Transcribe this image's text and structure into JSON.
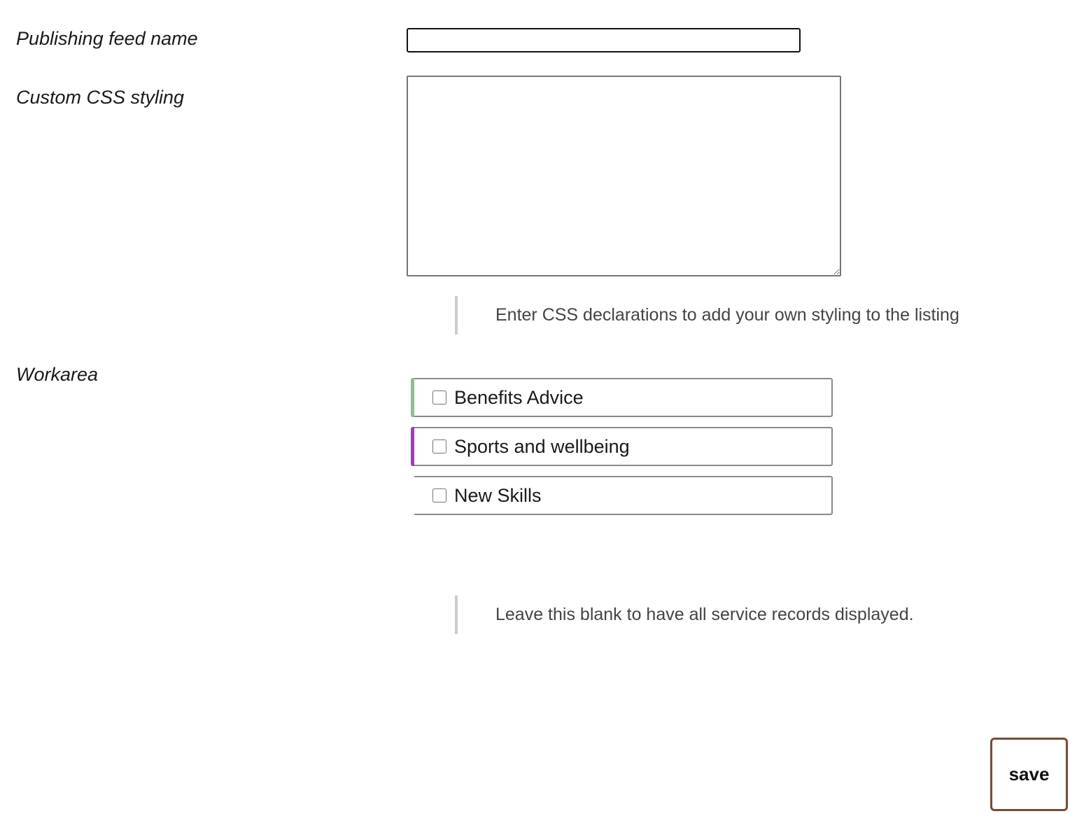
{
  "form": {
    "feed_name": {
      "label": "Publishing feed name",
      "value": ""
    },
    "custom_css": {
      "label": "Custom CSS styling",
      "value": "",
      "help": "Enter CSS declarations to add your own styling to the listing"
    },
    "workarea": {
      "label": "Workarea",
      "options": [
        {
          "label": "Benefits Advice",
          "checked": false,
          "accent_color": "#8fbf8f"
        },
        {
          "label": "Sports and wellbeing",
          "checked": false,
          "accent_color": "#a23bbf"
        },
        {
          "label": "New Skills",
          "checked": false,
          "accent_color": "#ffffff"
        }
      ],
      "help": "Leave this blank to have all service records displayed."
    }
  },
  "actions": {
    "save_label": "save",
    "save_border_color": "#7a4a35"
  }
}
